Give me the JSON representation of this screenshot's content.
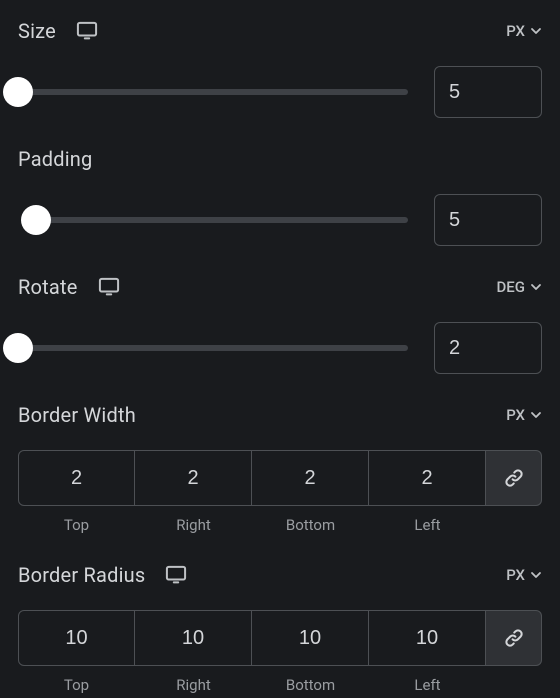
{
  "size": {
    "label": "Size",
    "unit": "PX",
    "value": "5"
  },
  "padding": {
    "label": "Padding",
    "value": "5"
  },
  "rotate": {
    "label": "Rotate",
    "unit": "DEG",
    "value": "2"
  },
  "borderWidth": {
    "label": "Border Width",
    "unit": "PX",
    "top": "2",
    "right": "2",
    "bottom": "2",
    "left": "2",
    "side_labels": {
      "top": "Top",
      "right": "Right",
      "bottom": "Bottom",
      "left": "Left"
    }
  },
  "borderRadius": {
    "label": "Border Radius",
    "unit": "PX",
    "top": "10",
    "right": "10",
    "bottom": "10",
    "left": "10",
    "side_labels": {
      "top": "Top",
      "right": "Right",
      "bottom": "Bottom",
      "left": "Left"
    }
  }
}
